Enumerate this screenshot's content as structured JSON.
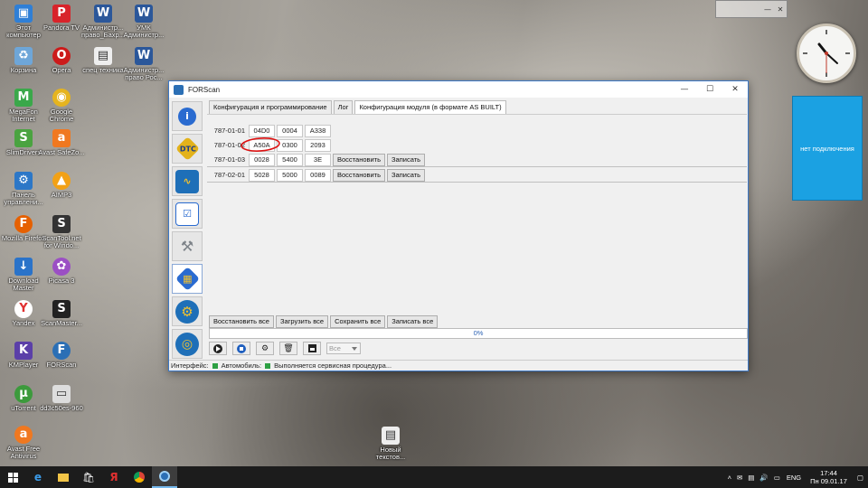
{
  "desktop": {
    "icons": [
      {
        "label": "Этот компьютер",
        "glyph": "🖥",
        "color": "#2f7fd6"
      },
      {
        "label": "Корзина",
        "glyph": "🗑",
        "color": "#6ea6d8"
      },
      {
        "label": "MegaFon Internet",
        "glyph": "M",
        "color": "#3aa84a"
      },
      {
        "label": "SlimDrivers",
        "glyph": "S",
        "color": "#4aa340"
      },
      {
        "label": "Панель управлени...",
        "glyph": "⚙",
        "color": "#2c77c7"
      },
      {
        "label": "Mozilla Firefox",
        "glyph": "F",
        "color": "#e66000"
      },
      {
        "label": "Download Master",
        "glyph": "D",
        "color": "#2a73c9"
      },
      {
        "label": "Yandex",
        "glyph": "Y",
        "color": "#e03030"
      },
      {
        "label": "KMPlayer",
        "glyph": "K",
        "color": "#5b3fa8"
      },
      {
        "label": "uTorrent",
        "glyph": "µ",
        "color": "#3c9a3c"
      },
      {
        "label": "Avast Free Antivirus",
        "glyph": "a",
        "color": "#f07820"
      },
      {
        "label": "Pandora TV",
        "glyph": "P",
        "color": "#d8232a"
      },
      {
        "label": "Opera",
        "glyph": "O",
        "color": "#cc1b1b"
      },
      {
        "label": "Google Chrome",
        "glyph": "◉",
        "color": "#e6b41e"
      },
      {
        "label": "Avast SafeZo...",
        "glyph": "a",
        "color": "#f07820"
      },
      {
        "label": "AIMP3",
        "glyph": "▲",
        "color": "#f2a116"
      },
      {
        "label": "ScanTool.net for Windo...",
        "glyph": "S",
        "color": "#333"
      },
      {
        "label": "Picasa 3",
        "glyph": "✿",
        "color": "#9b4fc4"
      },
      {
        "label": "ScanMaster...",
        "glyph": "S",
        "color": "#222"
      },
      {
        "label": "FORScan",
        "glyph": "F",
        "color": "#2b6fb5"
      },
      {
        "label": "dd3c50es-960",
        "glyph": "▭",
        "color": "#ddd"
      },
      {
        "label": "Администр... право_Бахр...",
        "glyph": "W",
        "color": "#2b579a"
      },
      {
        "label": "спец техника",
        "glyph": "▤",
        "color": "#eee"
      },
      {
        "label": "УМК Администр...",
        "glyph": "W",
        "color": "#2b579a"
      },
      {
        "label": "Администр... право Рос...",
        "glyph": "W",
        "color": "#2b579a"
      },
      {
        "label": "Новый текстов...",
        "glyph": "▤",
        "color": "#eee"
      }
    ]
  },
  "gadget": {
    "text": "нет подключения"
  },
  "window": {
    "title": "FORScan",
    "controls": {
      "minimize": "—",
      "maximize": "☐",
      "close": "✕"
    },
    "tabs": [
      {
        "label": "Конфигурация и программирование"
      },
      {
        "label": "Лог"
      },
      {
        "label": "Конфигурация модуля (в формате AS BUILT)"
      }
    ],
    "sidebar": [
      {
        "name": "info",
        "glyph": "i",
        "color": "#2a6bd0"
      },
      {
        "name": "dtc",
        "glyph": "DTC",
        "color": "#e3b21a"
      },
      {
        "name": "oscilloscope",
        "glyph": "∿",
        "color": "#1e6fb8"
      },
      {
        "name": "checklist",
        "glyph": "☑",
        "color": "#2a6bd0"
      },
      {
        "name": "wrench",
        "glyph": "🔧",
        "color": "#8a8f96"
      },
      {
        "name": "chip",
        "glyph": "▦",
        "color": "#2a6bd0"
      },
      {
        "name": "gear",
        "glyph": "⚙",
        "color": "#1e6fb8"
      },
      {
        "name": "steering",
        "glyph": "◎",
        "color": "#1e6fb8"
      }
    ],
    "rows": [
      {
        "addr": "787-01-01",
        "v1": "04D0",
        "v2": "0004",
        "v3": "A338",
        "restore": "",
        "write": ""
      },
      {
        "addr": "787-01-02",
        "v1": "A50A",
        "v2": "0300",
        "v3": "2093",
        "restore": "",
        "write": ""
      },
      {
        "addr": "787-01-03",
        "v1": "0028",
        "v2": "5400",
        "v3": "3E",
        "restore": "Восстановить",
        "write": "Записать"
      },
      {
        "addr": "787-02-01",
        "v1": "5028",
        "v2": "5000",
        "v3": "0089",
        "restore": "Восстановить",
        "write": "Записать"
      }
    ],
    "bottom_buttons": {
      "restore_all": "Восстановить все",
      "load_all": "Загрузить все",
      "save_all": "Сохранить все",
      "write_all": "Записать все"
    },
    "progress": {
      "text": "0%",
      "value": 0
    },
    "toolbar": {
      "select_value": "Все"
    },
    "status": {
      "interface_label": "Интерфейс:",
      "vehicle_label": "Автомобиль:",
      "message": "Выполняется сервисная процедура..."
    }
  },
  "taskbar": {
    "lang": "ENG",
    "time": "17:44",
    "date": "Пн 09.01.17"
  }
}
